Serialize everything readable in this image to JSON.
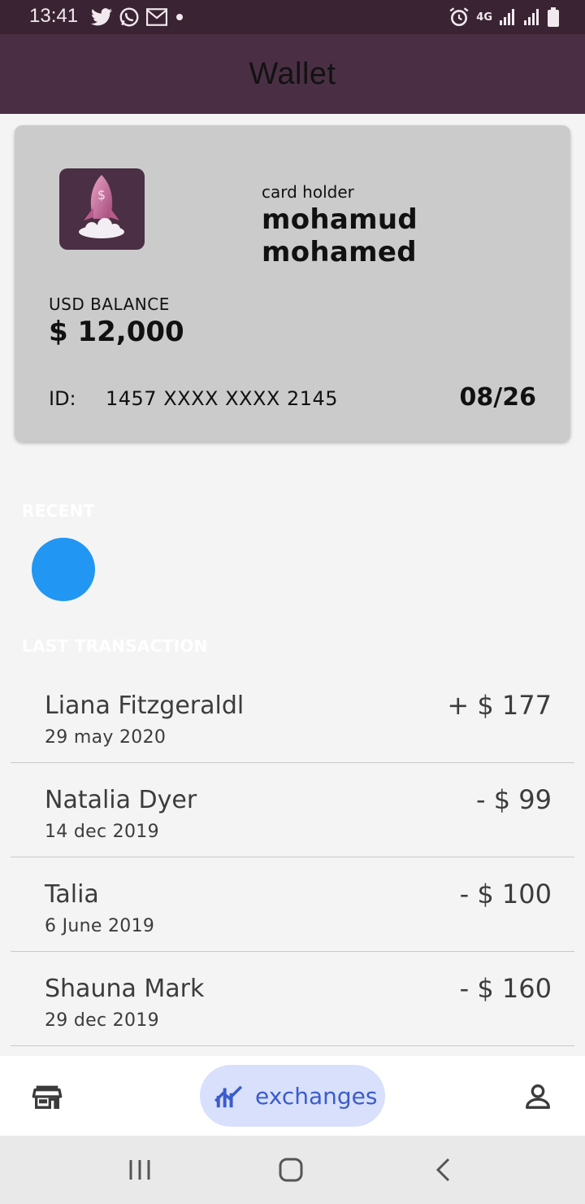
{
  "status_bar": {
    "time": "13:41",
    "network": "4G",
    "left_icons": [
      "twitter-icon",
      "whatsapp-icon",
      "gmail-icon",
      "dot-icon"
    ],
    "right_icons": [
      "alarm-icon",
      "signal-icon",
      "signal-icon",
      "battery-icon"
    ]
  },
  "app_bar": {
    "title": "Wallet"
  },
  "card": {
    "logo_icon": "rocket-dollar-icon",
    "holder_label": "card holder",
    "holder_name": "mohamud mohamed",
    "balance_label": "USD BALANCE",
    "balance_value": "$ 12,000",
    "id_label": "ID:",
    "id_value": "1457 XXXX XXXX 2145",
    "expiry": "08/26"
  },
  "recent": {
    "label": "RECENT"
  },
  "last_transaction": {
    "label": "LAST TRANSACTION",
    "items": [
      {
        "name": "Liana Fitzgeraldl",
        "date": "29 may 2020",
        "amount": "+ $ 177"
      },
      {
        "name": "Natalia Dyer",
        "date": "14 dec 2019",
        "amount": "- $ 99"
      },
      {
        "name": "Talia",
        "date": "6 June 2019",
        "amount": "- $ 100"
      },
      {
        "name": "Shauna Mark",
        "date": "29 dec 2019",
        "amount": "- $ 160"
      }
    ]
  },
  "bottom_nav": {
    "items": [
      {
        "icon": "store-icon"
      },
      {
        "icon": "exchanges-chart-icon",
        "label": "exchanges",
        "selected": true
      },
      {
        "icon": "person-icon"
      }
    ]
  },
  "colors": {
    "status_bar_bg": "#3a2433",
    "app_bar_bg": "#4a2f44",
    "card_bg": "#cbcbcb",
    "avatar": "#2196f3",
    "nav_selected_bg": "#d9e0fb",
    "nav_selected_fg": "#3b5ccc"
  }
}
